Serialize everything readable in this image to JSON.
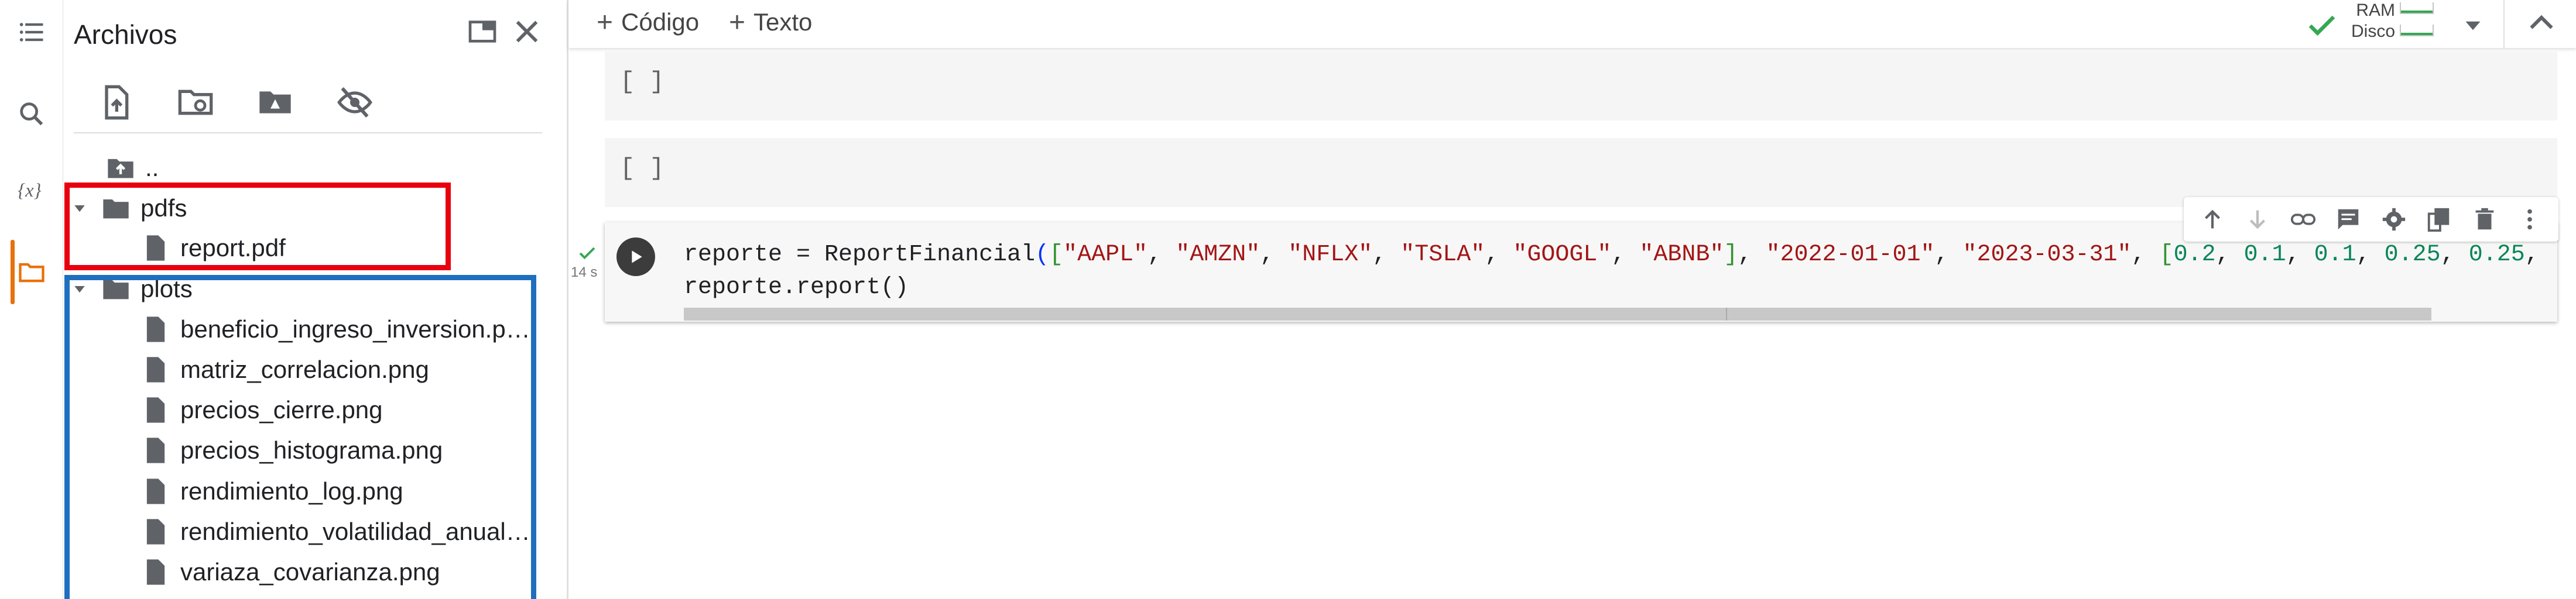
{
  "panel": {
    "title": "Archivos",
    "parent_label": "..",
    "folders": [
      {
        "label": "pdfs",
        "files": [
          "report.pdf"
        ]
      },
      {
        "label": "plots",
        "files": [
          "beneficio_ingreso_inversion.png",
          "matriz_correlacion.png",
          "precios_cierre.png",
          "precios_histograma.png",
          "rendimiento_log.png",
          "rendimiento_volatilidad_anualiz...",
          "variaza_covarianza.png"
        ]
      }
    ]
  },
  "toolbar": {
    "add_code": "Código",
    "add_text": "Texto",
    "ram_label": "RAM",
    "disk_label": "Disco"
  },
  "cells": {
    "empty_bracket": "[ ]",
    "exec_time": "14 s",
    "code_line2": "reporte.report()"
  },
  "colors": {
    "accent_orange": "#e8710a",
    "highlight_red": "#e8000e",
    "highlight_blue": "#1f6fbf",
    "ok_green": "#34a853"
  }
}
